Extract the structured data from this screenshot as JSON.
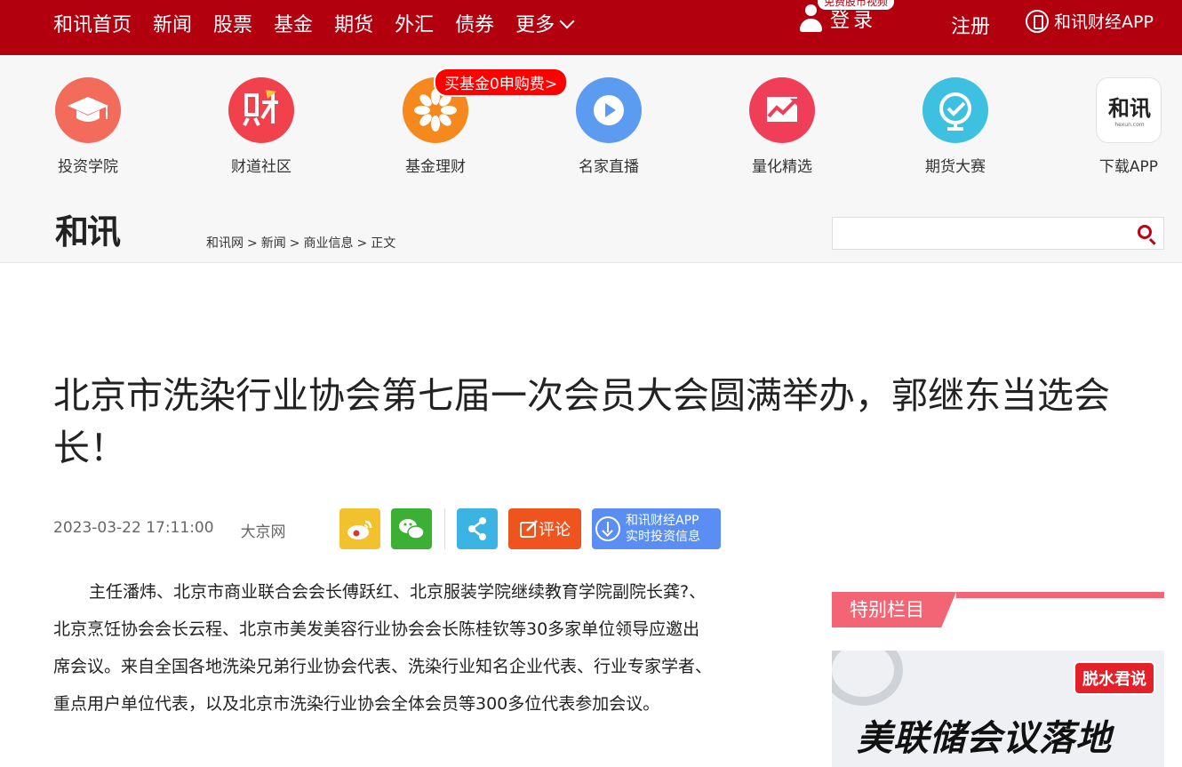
{
  "topnav": {
    "items": [
      "和讯首页",
      "新闻",
      "股票",
      "基金",
      "期货",
      "外汇",
      "债券",
      "更多"
    ],
    "login_label": "登录",
    "login_bubble": "免费股市视频",
    "register_label": "注册",
    "app_label": "和讯财经APP"
  },
  "services": [
    {
      "name": "投资学院",
      "icon": "mortarboard-icon",
      "color": "#f26b5b"
    },
    {
      "name": "财道社区",
      "icon": "cai-icon",
      "color": "#f0414d"
    },
    {
      "name": "基金理财",
      "icon": "flower-icon",
      "color": "#f5891d"
    },
    {
      "name": "名家直播",
      "icon": "play-icon",
      "color": "#5b9cf0"
    },
    {
      "name": "量化精选",
      "icon": "chart-up-icon",
      "color": "#f03e59"
    },
    {
      "name": "期货大赛",
      "icon": "globe-icon",
      "color": "#3ec1e0"
    },
    {
      "name": "下载APP",
      "icon": "hexun-logo-icon",
      "color": "#ffffff"
    }
  ],
  "promo_tag": "买基金0申购费>",
  "logo_text": "和讯",
  "breadcrumb": [
    "和讯网",
    "新闻",
    "商业信息",
    "正文"
  ],
  "breadcrumb_sep": ">",
  "search": {
    "value": "",
    "placeholder": ""
  },
  "article": {
    "title": "北京市洗染行业协会第七届一次会员大会圆满举办，郭继东当选会长！",
    "date": "2023-03-22 17:11:00",
    "source": "大京网",
    "body": "主任潘炜、北京市商业联合会会长傅跃红、北京服装学院继续教育学院副院长龚?、北京烹饪协会会长云程、北京市美发美容行业协会会长陈桂钦等30多家单位领导应邀出席会议。来自全国各地洗染兄弟行业协会代表、洗染行业知名企业代表、行业专家学者、重点用户单位代表，以及北京市洗染行业协会全体会员等300多位代表参加会议。"
  },
  "share": {
    "comment_label": "评论",
    "app_line1": "和讯财经APP",
    "app_line2": "实时投资信息",
    "colors": {
      "weibo": "#f2c12e",
      "wechat": "#3cb034",
      "share": "#3bb3e3",
      "comment": "#f0541e",
      "app": "#5a8ef2"
    }
  },
  "sidebar": {
    "section_title": "特别栏目",
    "card_badge": "脱水君说",
    "card_headline": "美联储会议落地"
  },
  "colors": {
    "brand_red": "#b3000f",
    "accent_pink": "#f36574"
  }
}
